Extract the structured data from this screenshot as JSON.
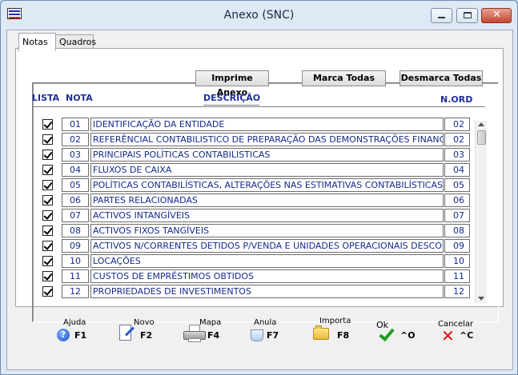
{
  "window": {
    "title": "Anexo (SNC)"
  },
  "tabs": [
    {
      "label": "Notas"
    },
    {
      "label": "Quadros"
    }
  ],
  "buttons": {
    "imprime": "Imprime Anexo",
    "marca": "Marca Todas",
    "desmarca": "Desmarca Todas"
  },
  "columns": {
    "lista": "LISTA",
    "nota": "NOTA",
    "descricao": "DESCRIÇÃO",
    "nord": "N.ORD"
  },
  "rows": [
    {
      "checked": true,
      "nota": "01",
      "descricao": "IDENTIFICAÇÃO DA ENTIDADE",
      "nord": "02"
    },
    {
      "checked": true,
      "nota": "02",
      "descricao": "REFERÊNCIAL CONTABILISTICO DE PREPARAÇÃO DAS DEMONSTRAÇÕES FINANCEIRAS",
      "nord": "02"
    },
    {
      "checked": true,
      "nota": "03",
      "descricao": "PRINCIPAIS POLÍTICAS CONTABILISTICAS",
      "nord": "03"
    },
    {
      "checked": true,
      "nota": "04",
      "descricao": "FLUXOS DE CAIXA",
      "nord": "04"
    },
    {
      "checked": true,
      "nota": "05",
      "descricao": "POLÍTICAS CONTABILÍSTICAS, ALTERAÇÕES NAS ESTIMATIVAS CONTABILÍSTICAS E ERROS",
      "nord": "05"
    },
    {
      "checked": true,
      "nota": "06",
      "descricao": "PARTES RELACIONADAS",
      "nord": "06"
    },
    {
      "checked": true,
      "nota": "07",
      "descricao": "ACTIVOS INTANGÍVEIS",
      "nord": "07"
    },
    {
      "checked": true,
      "nota": "08",
      "descricao": "ACTIVOS FIXOS TANGÍVEIS",
      "nord": "08"
    },
    {
      "checked": true,
      "nota": "09",
      "descricao": "ACTIVOS N/CORRENTES DETIDOS P/VENDA E UNIDADES OPERACIONAIS DESCONTINUADAS",
      "nord": "09"
    },
    {
      "checked": true,
      "nota": "10",
      "descricao": "LOCAÇÕES",
      "nord": "10"
    },
    {
      "checked": true,
      "nota": "11",
      "descricao": "CUSTOS DE EMPRÉSTIMOS OBTIDOS",
      "nord": "11"
    },
    {
      "checked": true,
      "nota": "12",
      "descricao": "PROPRIEDADES DE INVESTIMENTOS",
      "nord": "12"
    }
  ],
  "toolbar": [
    {
      "label": "Ajuda",
      "key": "F1",
      "icon": "help-icon"
    },
    {
      "label": "Novo",
      "key": "F2",
      "icon": "new-document-icon"
    },
    {
      "label": "Mapa",
      "key": "F4",
      "icon": "printer-icon"
    },
    {
      "label": "Anula",
      "key": "F7",
      "icon": "cancel-document-icon"
    },
    {
      "label": "Importa",
      "key": "F8",
      "icon": "folder-icon"
    },
    {
      "label": "Ok",
      "key": "^O",
      "icon": "checkmark-icon"
    },
    {
      "label": "Cancelar",
      "key": "^C",
      "icon": "x-icon"
    }
  ],
  "colors": {
    "text_blue": "#142a8c",
    "header_blue": "#1c2e9c",
    "ok_green": "#1e9e1e",
    "cancel_red": "#d01010"
  }
}
